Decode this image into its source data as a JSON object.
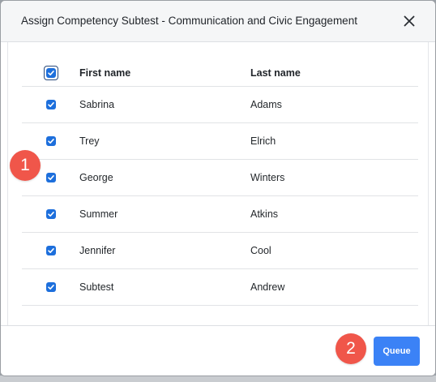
{
  "dialog": {
    "title": "Assign Competency Subtest - Communication and Civic Engagement",
    "close_icon": "close-icon"
  },
  "table": {
    "columns": {
      "select_all_checked": true,
      "first_name": "First name",
      "last_name": "Last name"
    },
    "rows": [
      {
        "checked": true,
        "first": "Sabrina",
        "last": "Adams"
      },
      {
        "checked": true,
        "first": "Trey",
        "last": "Elrich"
      },
      {
        "checked": true,
        "first": "George",
        "last": "Winters"
      },
      {
        "checked": true,
        "first": "Summer",
        "last": "Atkins"
      },
      {
        "checked": true,
        "first": "Jennifer",
        "last": "Cool"
      },
      {
        "checked": true,
        "first": "Subtest",
        "last": "Andrew"
      }
    ]
  },
  "footer": {
    "queue_label": "Queue"
  },
  "annotations": {
    "step_1": "1",
    "step_2": "2"
  },
  "colors": {
    "accent": "#3b82f6",
    "checkbox": "#1d6fdc",
    "badge": "#f0564a"
  }
}
